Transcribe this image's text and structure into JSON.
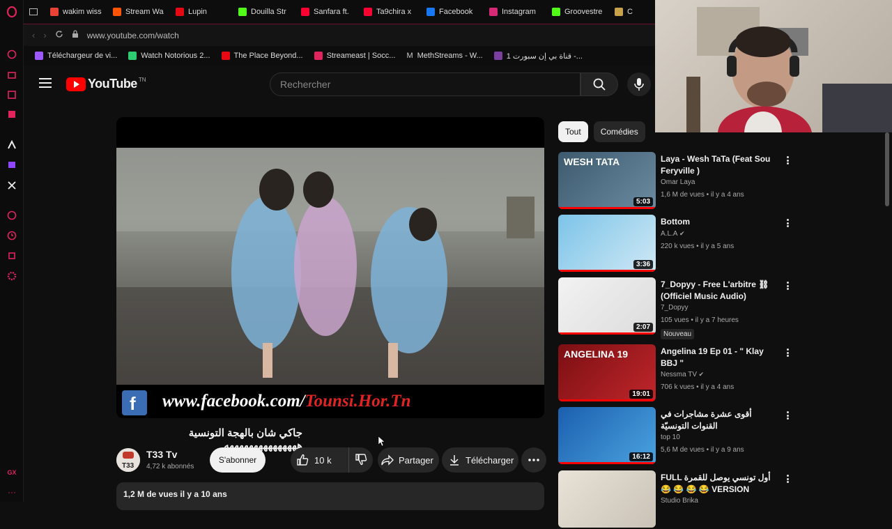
{
  "browser": {
    "tabs": [
      {
        "label": "wakim wiss",
        "color": "#ea4335"
      },
      {
        "label": "Stream Wa",
        "color": "#ff5500"
      },
      {
        "label": "Lupin",
        "color": "#e50914"
      },
      {
        "label": "Douilla Str",
        "color": "#53fc18"
      },
      {
        "label": "Sanfara ft.",
        "color": "#ff0033"
      },
      {
        "label": "Ta9chira x",
        "color": "#ff0033"
      },
      {
        "label": "Facebook",
        "color": "#1877f2"
      },
      {
        "label": "Instagram",
        "color": "#d62976"
      },
      {
        "label": "Groovestre",
        "color": "#53fc18"
      },
      {
        "label": "C",
        "color": "#c8a24a"
      }
    ],
    "url": "www.youtube.com/watch",
    "bookmarks": [
      {
        "label": "Téléchargeur de vi...",
        "color": "#9b59ff"
      },
      {
        "label": "Watch Notorious 2...",
        "color": "#2ecc71"
      },
      {
        "label": "The Place Beyond...",
        "color": "#e50914"
      },
      {
        "label": "Streameast | Socc...",
        "color": "#e0245e"
      },
      {
        "label": "MethStreams - W...",
        "color": "#cccccc",
        "glyph": "M"
      },
      {
        "label": "قناة بي إن سبورت 1 -...",
        "color": "#7b3fa0"
      }
    ]
  },
  "youtube": {
    "logo_text": "YouTube",
    "logo_sup": "TN",
    "search_placeholder": "Rechercher"
  },
  "video": {
    "watermark_url": "www.facebook.com/",
    "watermark_page": "Tounsi.Hor.Tn",
    "title": "جاكي شان بالهجة التونسية هههههههههههههههه",
    "channel_name": "T33 Tv",
    "subscribers": "4,72 k abonnés",
    "subscribe_label": "S'abonner",
    "likes": "10 k",
    "share_label": "Partager",
    "download_label": "Télécharger",
    "views_date": "1,2 M de vues  il y a 10 ans"
  },
  "chips": [
    "Tout",
    "Comédies"
  ],
  "recommendations": [
    {
      "title": "Laya - Wesh TaTa (Feat Sou Feryville )",
      "channel": "Omar Laya",
      "meta": "1,6 M de vues • il y a 4 ans",
      "duration": "5:03",
      "thumb_text": "WESH TATA",
      "verified": false,
      "badge": ""
    },
    {
      "title": "Bottom",
      "channel": "A.L.A",
      "meta": "220 k vues • il y a 5 ans",
      "duration": "3:36",
      "thumb_text": "",
      "verified": true,
      "badge": ""
    },
    {
      "title": "7_Dopyy - Free L'arbitre ⛓ (Officiel Music Audio)",
      "channel": "7_Dopyy",
      "meta": "105 vues • il y a 7 heures",
      "duration": "2:07",
      "thumb_text": "",
      "verified": false,
      "badge": "Nouveau"
    },
    {
      "title": "Angelina 19 Ep 01 - \" Klay BBJ \"",
      "channel": "Nessma TV",
      "meta": "706 k vues • il y a 4 ans",
      "duration": "19:01",
      "thumb_text": "ANGELINA 19",
      "verified": true,
      "badge": ""
    },
    {
      "title": "أقوى عشرة مشاجرات في القنوات التونسيّة",
      "channel": "top 10",
      "meta": "5,6 M de vues • il y a 9 ans",
      "duration": "16:12",
      "thumb_text": "",
      "verified": false,
      "badge": ""
    },
    {
      "title": "FULL أول تونسي يوصل للقمرة 😂 😂 😂 😂 VERSION",
      "channel": "Studio Brika",
      "meta": "",
      "duration": "",
      "thumb_text": "",
      "verified": false,
      "badge": ""
    }
  ]
}
